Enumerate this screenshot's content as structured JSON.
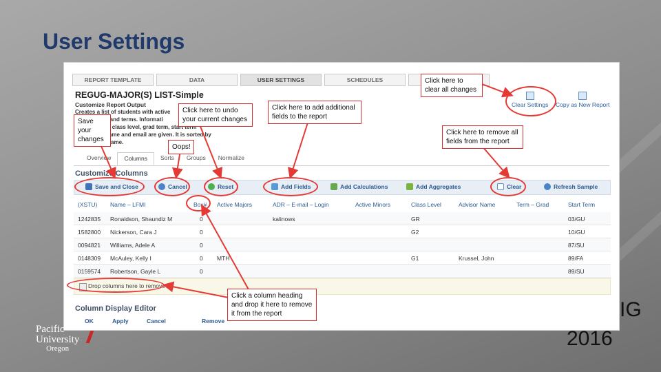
{
  "slide": {
    "title": "User Settings",
    "conference_fragment": "IG",
    "year": "2016"
  },
  "logo": {
    "line1": "Pacific",
    "line2": "University",
    "line3": "Oregon"
  },
  "top_tabs": [
    {
      "label": "REPORT TEMPLATE",
      "active": false
    },
    {
      "label": "DATA",
      "active": false
    },
    {
      "label": "USER SETTINGS",
      "active": true
    },
    {
      "label": "SCHEDULES",
      "active": false
    },
    {
      "label": "",
      "active": false
    }
  ],
  "report": {
    "title": "REGUG-MAJOR(S) LIST-Simple",
    "subtitle": "Customize Report Output",
    "description_lines": [
      "Creates a list of students with active",
      "s and terms. Informati",
      "nt class level, grad term, start term",
      "name and email are given. It is sorted by",
      "student last name."
    ]
  },
  "top_actions": {
    "clear_settings": "Clear Settings",
    "copy_as_new": "Copy as New Report"
  },
  "sub_tabs": [
    "Overview",
    "Columns",
    "Sorts",
    "Groups",
    "Normalize"
  ],
  "customize_heading": "Customize Columns",
  "toolbar": {
    "save_close": "Save and Close",
    "cancel": "Cancel",
    "reset": "Reset",
    "add_fields": "Add Fields",
    "add_calculations": "Add Calculations",
    "add_aggregates": "Add Aggregates",
    "clear": "Clear",
    "refresh_sample": "Refresh Sample"
  },
  "columns": [
    "(XSTU)",
    "Name – LFMI",
    "Box#",
    "Active Majors",
    "ADR – E-mail – Login",
    "Active Minors",
    "Class Level",
    "Advisor Name",
    "Term – Grad",
    "Start Term"
  ],
  "rows": [
    [
      "1242835",
      "Ronaldson, Shaundiz M",
      "0",
      "",
      "kalinows",
      "",
      "GR",
      "",
      "",
      "03/GU"
    ],
    [
      "1582800",
      "Nickerson, Cara J",
      "0",
      "",
      "",
      "",
      "G2",
      "",
      "",
      "10/GU"
    ],
    [
      "0094821",
      "Williams, Adele A",
      "0",
      "",
      "",
      "",
      "",
      "",
      "",
      "87/SU"
    ],
    [
      "0148309",
      "McAuley, Kelly I",
      "0",
      "MTH",
      "",
      "",
      "G1",
      "Krussel, John",
      "",
      "89/FA"
    ],
    [
      "0159574",
      "Robertson, Gayle L",
      "0",
      "",
      "",
      "",
      "",
      "",
      "",
      "89/SU"
    ]
  ],
  "drop_zone": "Drop columns here to remove",
  "editor": {
    "heading": "Column Display Editor",
    "ok": "OK",
    "apply": "Apply",
    "cancel": "Cancel",
    "remove": "Remove"
  },
  "callouts": {
    "clear_all": "Click here to clear all changes",
    "undo": "Click here to undo your current changes",
    "add_fields": "Click here to add additional fields to the report",
    "save": "Save your changes",
    "oops": "Oops!",
    "remove_all": "Click here to remove all fields from the report",
    "drag_heading": "Click a column heading and drop it here to remove it from the report"
  },
  "colors": {
    "title": "#1f3a6b",
    "callout_border": "#d32f2f",
    "link_blue": "#2c5a8f"
  }
}
